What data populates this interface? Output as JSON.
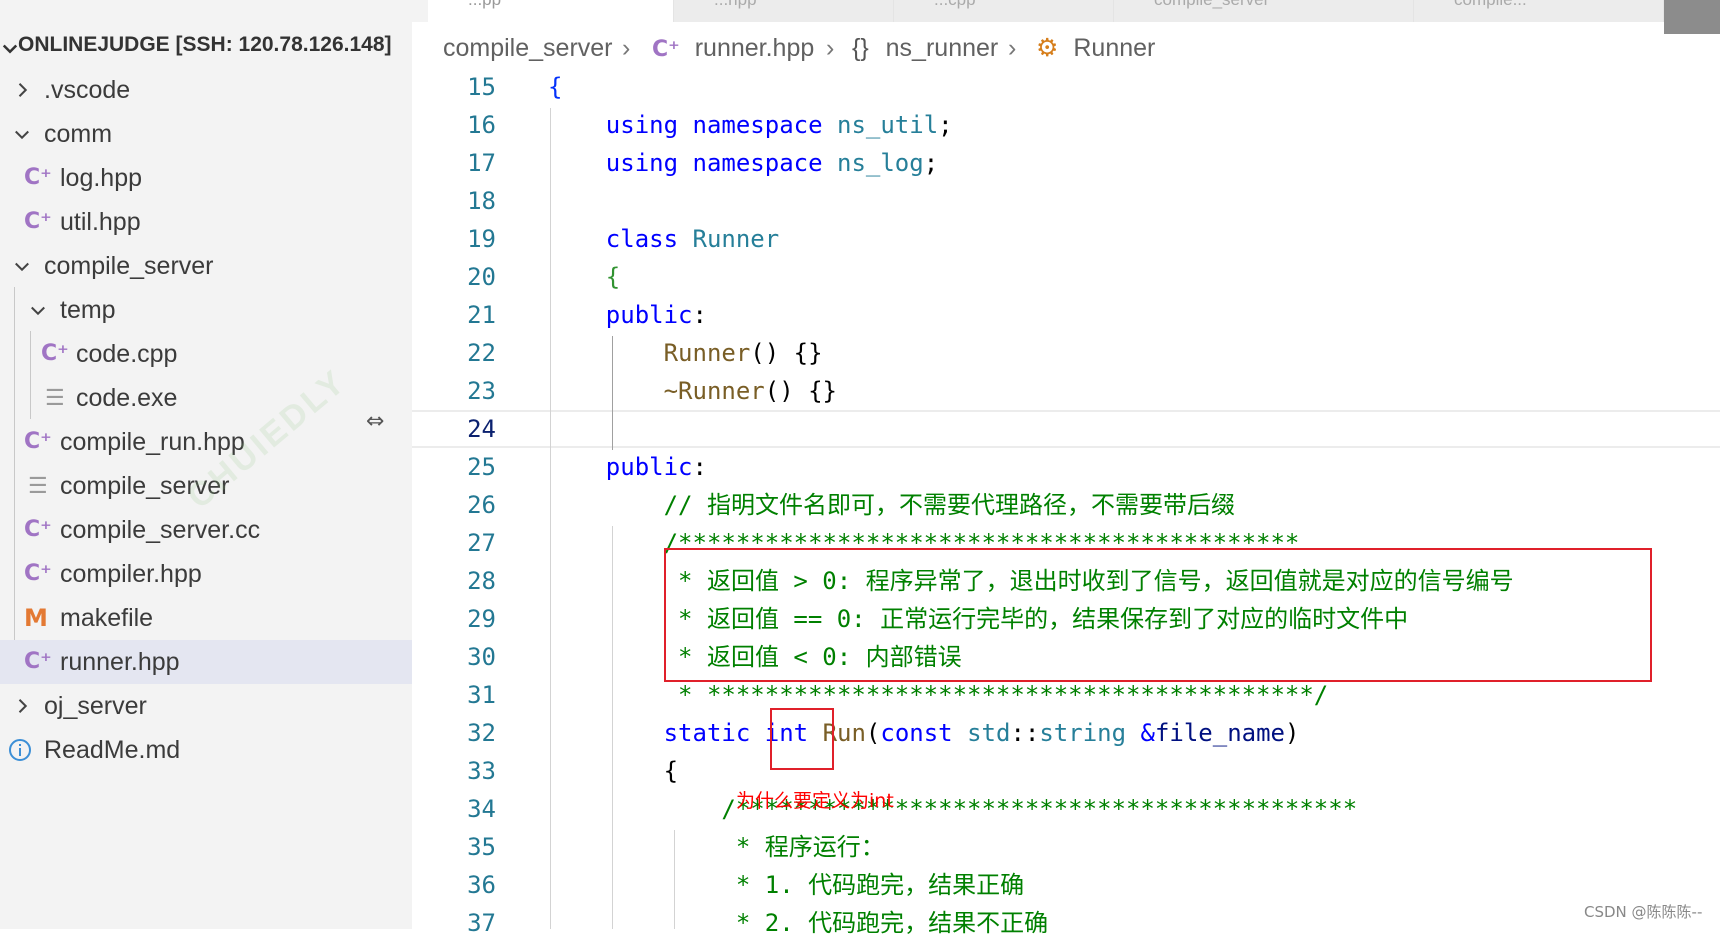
{
  "tabs": [
    {
      "label": "...pp",
      "active": true
    },
    {
      "label": "...hpp",
      "active": false
    },
    {
      "label": "...cpp",
      "active": false
    },
    {
      "label": "compile_server",
      "active": false
    },
    {
      "label": "compile...",
      "active": false
    }
  ],
  "explorer": {
    "title": "ONLINEJUDGE [SSH: 120.78.126.148]",
    "items": [
      {
        "label": ".vscode",
        "kind": "folder",
        "expanded": false
      },
      {
        "label": "comm",
        "kind": "folder",
        "expanded": true
      },
      {
        "label": "log.hpp",
        "kind": "cpp"
      },
      {
        "label": "util.hpp",
        "kind": "cpp"
      },
      {
        "label": "compile_server",
        "kind": "folder",
        "expanded": true
      },
      {
        "label": "temp",
        "kind": "folder",
        "expanded": true
      },
      {
        "label": "code.cpp",
        "kind": "cpp"
      },
      {
        "label": "code.exe",
        "kind": "text"
      },
      {
        "label": "compile_run.hpp",
        "kind": "cpp"
      },
      {
        "label": "compile_server",
        "kind": "text"
      },
      {
        "label": "compile_server.cc",
        "kind": "cpp"
      },
      {
        "label": "compiler.hpp",
        "kind": "cpp"
      },
      {
        "label": "makefile",
        "kind": "makefile"
      },
      {
        "label": "runner.hpp",
        "kind": "cpp",
        "selected": true
      },
      {
        "label": "oj_server",
        "kind": "folder",
        "expanded": false
      },
      {
        "label": "ReadMe.md",
        "kind": "info"
      }
    ]
  },
  "breadcrumb": {
    "folder": "compile_server",
    "file": "runner.hpp",
    "namespace": "ns_runner",
    "class": "Runner"
  },
  "editor": {
    "current_line": 24,
    "lines": [
      {
        "n": "15",
        "tokens": [
          [
            "br",
            "{"
          ]
        ]
      },
      {
        "n": "16",
        "tokens": [
          [
            "kw",
            "using"
          ],
          [
            "pl",
            " "
          ],
          [
            "kw",
            "namespace"
          ],
          [
            "pl",
            " "
          ],
          [
            "ns",
            "ns_util"
          ],
          [
            "pl",
            ";"
          ]
        ]
      },
      {
        "n": "17",
        "tokens": [
          [
            "kw",
            "using"
          ],
          [
            "pl",
            " "
          ],
          [
            "kw",
            "namespace"
          ],
          [
            "pl",
            " "
          ],
          [
            "ns",
            "ns_log"
          ],
          [
            "pl",
            ";"
          ]
        ]
      },
      {
        "n": "18",
        "tokens": []
      },
      {
        "n": "19",
        "tokens": [
          [
            "kw",
            "class"
          ],
          [
            "pl",
            " "
          ],
          [
            "ty",
            "Runner"
          ]
        ]
      },
      {
        "n": "20",
        "tokens": [
          [
            "br2",
            "{"
          ]
        ]
      },
      {
        "n": "21",
        "tokens": [
          [
            "kw",
            "public"
          ],
          [
            "pl",
            ":"
          ]
        ]
      },
      {
        "n": "22",
        "tokens": [
          [
            "fn",
            "Runner"
          ],
          [
            "pl",
            "() {}"
          ]
        ]
      },
      {
        "n": "23",
        "tokens": [
          [
            "fn",
            "~Runner"
          ],
          [
            "pl",
            "() {}"
          ]
        ]
      },
      {
        "n": "24",
        "tokens": []
      },
      {
        "n": "25",
        "tokens": [
          [
            "kw",
            "public"
          ],
          [
            "pl",
            ":"
          ]
        ]
      },
      {
        "n": "26",
        "tokens": [
          [
            "cm",
            "// 指明文件名即可，不需要代理路径，不需要带后缀"
          ]
        ]
      },
      {
        "n": "27",
        "tokens": [
          [
            "cm",
            "/*******************************************"
          ]
        ]
      },
      {
        "n": "28",
        "tokens": [
          [
            "cm",
            " * 返回值 > 0: 程序异常了，退出时收到了信号，返回值就是对应的信号编号"
          ]
        ]
      },
      {
        "n": "29",
        "tokens": [
          [
            "cm",
            " * 返回值 == 0: 正常运行完毕的，结果保存到了对应的临时文件中"
          ]
        ]
      },
      {
        "n": "30",
        "tokens": [
          [
            "cm",
            " * 返回值 < 0: 内部错误"
          ]
        ]
      },
      {
        "n": "31",
        "tokens": [
          [
            "cm",
            " * ******************************************/"
          ]
        ]
      },
      {
        "n": "32",
        "tokens": [
          [
            "kw",
            "static"
          ],
          [
            "pl",
            " "
          ],
          [
            "kw",
            "int"
          ],
          [
            "pl",
            " "
          ],
          [
            "fn",
            "Run"
          ],
          [
            "pl",
            "("
          ],
          [
            "kw",
            "const"
          ],
          [
            "pl",
            " "
          ],
          [
            "ty",
            "std"
          ],
          [
            "pl",
            "::"
          ],
          [
            "ty",
            "string"
          ],
          [
            "pl",
            " "
          ],
          [
            "kw",
            "&"
          ],
          [
            "par",
            "file_name"
          ],
          [
            "pl",
            ")"
          ]
        ]
      },
      {
        "n": "33",
        "tokens": [
          [
            "pl",
            "{"
          ]
        ]
      },
      {
        "n": "34",
        "tokens": [
          [
            "cm",
            "/*******************************************"
          ]
        ]
      },
      {
        "n": "35",
        "tokens": [
          [
            "cm",
            " * 程序运行："
          ]
        ]
      },
      {
        "n": "36",
        "tokens": [
          [
            "cm",
            " * 1. 代码跑完，结果正确"
          ]
        ]
      },
      {
        "n": "37",
        "tokens": [
          [
            "cm",
            " * 2. 代码跑完，结果不正确"
          ]
        ]
      }
    ]
  },
  "annotation": {
    "text": "为什么要定义为int"
  },
  "watermark_text": "CHUIEDLY",
  "csdn_watermark": "CSDN @陈陈陈--",
  "colors": {
    "keyword": "#0000ff",
    "type": "#267f99",
    "function": "#795e26",
    "comment": "#008000",
    "line_number": "#237893",
    "highlight_box": "#e0202a",
    "annotation": "#ff0000",
    "sidebar_bg": "#f3f3f3",
    "selected_bg": "#e4e6f1"
  }
}
